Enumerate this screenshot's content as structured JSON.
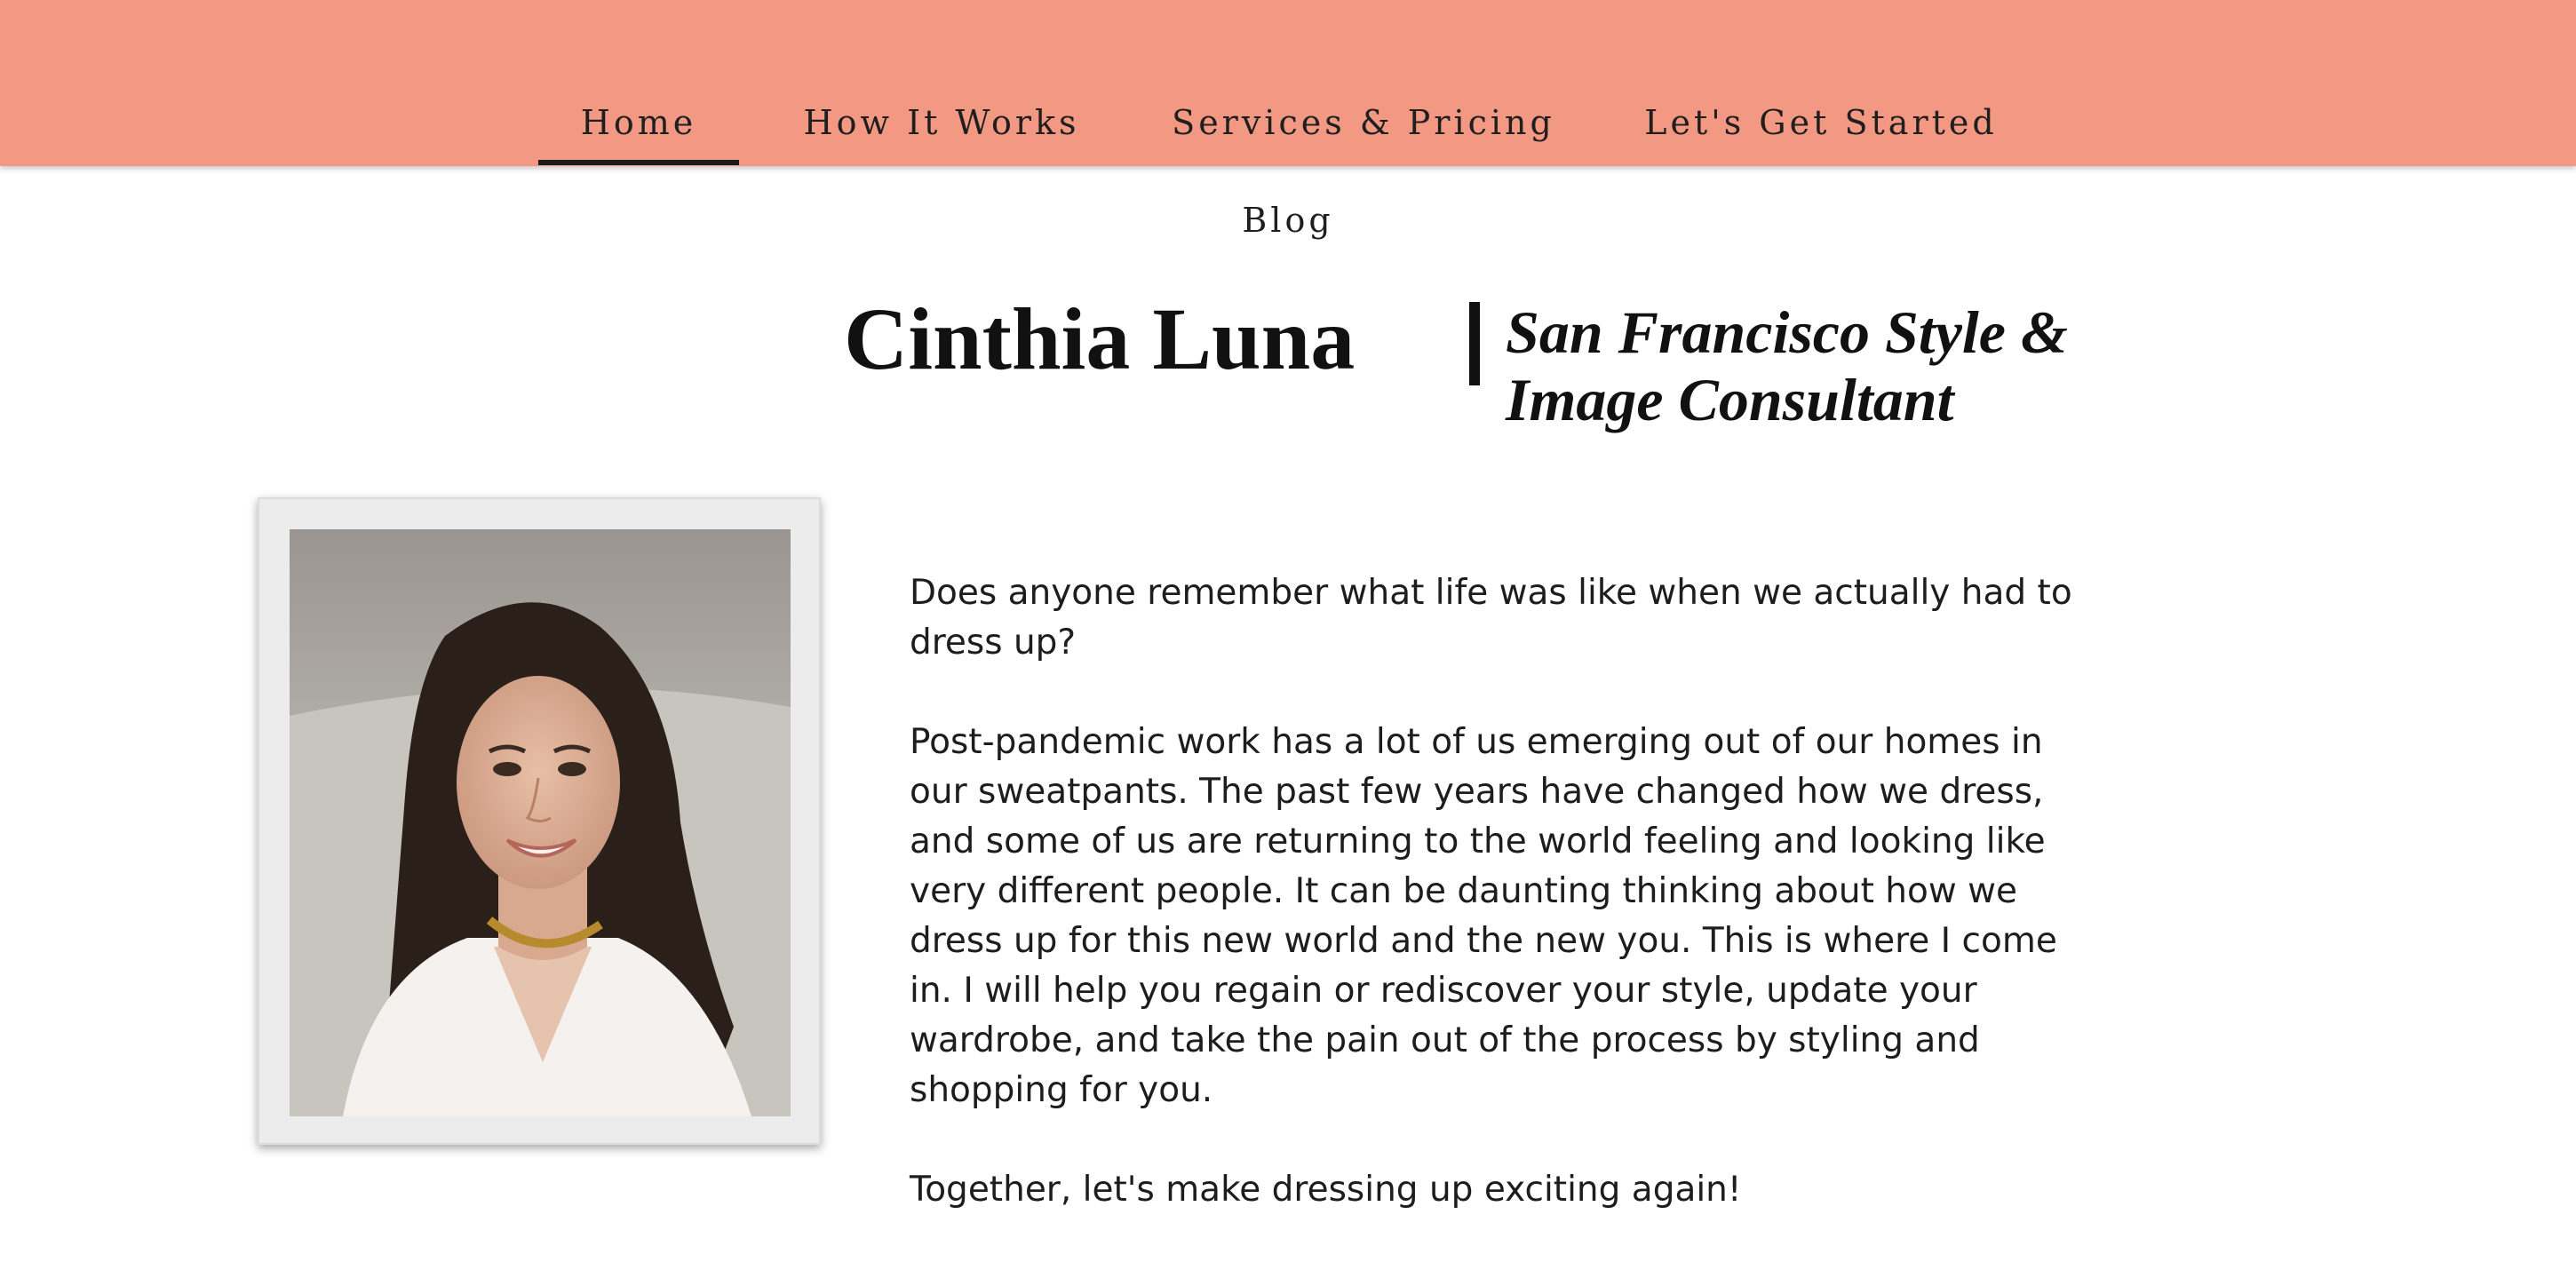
{
  "nav": {
    "items": [
      {
        "label": "Home",
        "active": true
      },
      {
        "label": "How It Works",
        "active": false
      },
      {
        "label": "Services & Pricing",
        "active": false
      },
      {
        "label": "Let's Get Started",
        "active": false
      },
      {
        "label": "Blog",
        "active": false
      }
    ]
  },
  "hero": {
    "name": "Cinthia Luna",
    "tagline_line1": "San Francisco Style &",
    "tagline_line2": "Image Consultant"
  },
  "photo": {
    "icon": "portrait-photo"
  },
  "intro": {
    "paragraphs": [
      "Does anyone remember what life was like when we actually had to dress up?",
      "Post-pandemic work has a lot of us emerging out of our homes in our sweatpants. The past few years have changed how we dress, and some of us are returning to the world feeling and looking like very different people. It can be daunting thinking about how we dress up for this new world and the new you. This is where I come in. I will help you regain or rediscover your style, update your wardrobe, and take the pain out of the process by styling and shopping for you.",
      "Together, let's make dressing up exciting again!"
    ]
  },
  "colors": {
    "header_bg": "#f29883",
    "text": "#1d1d1d"
  }
}
